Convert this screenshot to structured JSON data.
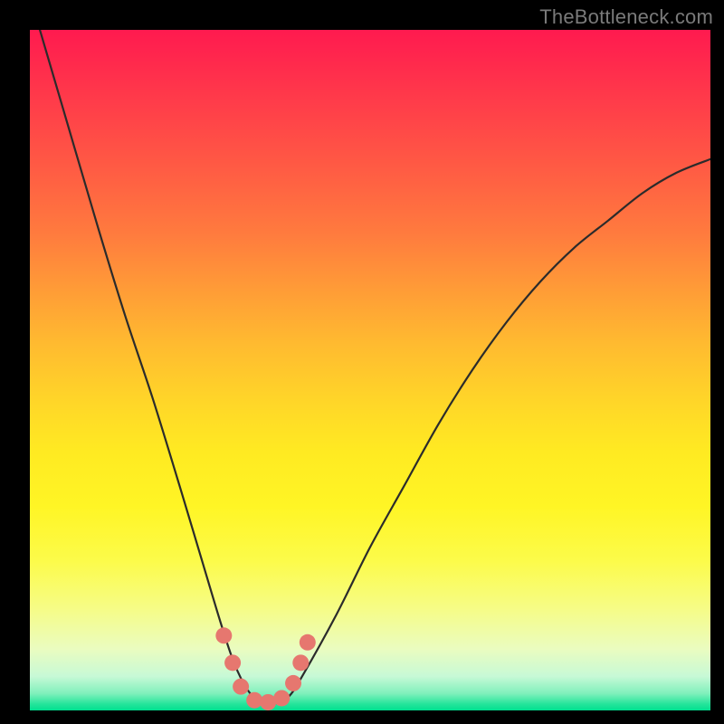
{
  "watermark": "TheBottleneck.com",
  "colors": {
    "background": "#000000",
    "curve_stroke": "#2b2b2b",
    "marker_fill": "#e6776f",
    "gradient_top": "#ff1a4f",
    "gradient_bottom": "#00df8f"
  },
  "chart_data": {
    "type": "line",
    "title": "",
    "xlabel": "",
    "ylabel": "",
    "xlim": [
      0,
      100
    ],
    "ylim": [
      0,
      100
    ],
    "grid": false,
    "series": [
      {
        "name": "bottleneck-curve",
        "x": [
          0,
          5,
          10,
          14,
          18,
          22,
          25,
          28,
          30,
          32,
          34,
          36,
          38,
          40,
          45,
          50,
          55,
          60,
          65,
          70,
          75,
          80,
          85,
          90,
          95,
          100
        ],
        "y": [
          105,
          88,
          71,
          58,
          46,
          33,
          23,
          13,
          7,
          3,
          1,
          1,
          2,
          5,
          14,
          24,
          33,
          42,
          50,
          57,
          63,
          68,
          72,
          76,
          79,
          81
        ]
      }
    ],
    "markers": [
      {
        "x": 28.5,
        "y": 11
      },
      {
        "x": 29.8,
        "y": 7
      },
      {
        "x": 31.0,
        "y": 3.5
      },
      {
        "x": 33.0,
        "y": 1.5
      },
      {
        "x": 35.0,
        "y": 1.2
      },
      {
        "x": 37.0,
        "y": 1.8
      },
      {
        "x": 38.7,
        "y": 4
      },
      {
        "x": 39.8,
        "y": 7
      },
      {
        "x": 40.8,
        "y": 10
      }
    ]
  }
}
